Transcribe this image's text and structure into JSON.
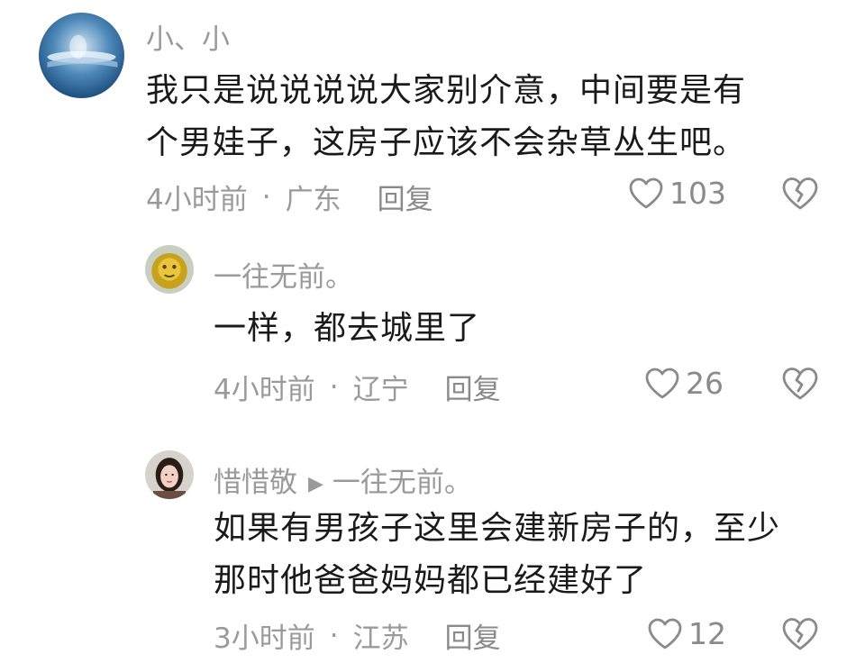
{
  "comments": [
    {
      "author": "小、小",
      "text_lines": [
        "我只是说说说说大家别介意，中间要是有",
        "个男娃子，这房子应该不会杂草丛生吧。"
      ],
      "time": "4小时前",
      "location": "广东",
      "reply_label": "回复",
      "likes": "103",
      "avatar_icon": "water-avatar"
    },
    {
      "author": "一往无前。",
      "text_lines": [
        "一样，都去城里了"
      ],
      "time": "4小时前",
      "location": "辽宁",
      "reply_label": "回复",
      "likes": "26",
      "avatar_icon": "golden-lion-avatar"
    },
    {
      "author": "惜惜敬",
      "reply_to": "一往无前。",
      "text_lines": [
        "如果有男孩子这里会建新房子的，至少",
        "那时他爸爸妈妈都已经建好了"
      ],
      "time": "3小时前",
      "location": "江苏",
      "reply_label": "回复",
      "likes": "12",
      "avatar_icon": "woman-portrait-avatar"
    }
  ],
  "separator": "·",
  "colors": {
    "text": "#1a1a1a",
    "meta": "#9a9a9a",
    "icon": "#8a8a8a"
  }
}
